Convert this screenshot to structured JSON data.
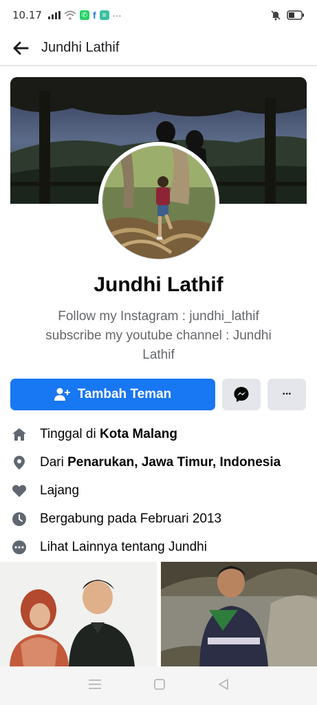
{
  "status_bar": {
    "time": "10.17",
    "more": "···"
  },
  "header": {
    "title": "Jundhi Lathif"
  },
  "profile": {
    "name": "Jundhi Lathif",
    "bio_lines": [
      "Follow my Instagram : jundhi_lathif",
      "subscribe my youtube channel : Jundhi",
      "Lathif"
    ]
  },
  "actions": {
    "add_friend_label": "Tambah Teman",
    "more_label": "···"
  },
  "info": [
    {
      "icon": "home-icon",
      "prefix": "Tinggal di ",
      "bold": "Kota Malang"
    },
    {
      "icon": "location-pin-icon",
      "prefix": "Dari ",
      "bold": "Penarukan, Jawa Timur, Indonesia"
    },
    {
      "icon": "heart-icon",
      "prefix": "Lajang",
      "bold": ""
    },
    {
      "icon": "clock-icon",
      "prefix": "Bergabung pada Februari 2013",
      "bold": ""
    },
    {
      "icon": "more-dots-icon",
      "prefix": "Lihat Lainnya tentang Jundhi",
      "bold": ""
    }
  ],
  "colors": {
    "primary": "#1877f2",
    "secondary_bg": "#e4e6eb",
    "muted_text": "#65676b",
    "icon_gray": "#606770"
  }
}
